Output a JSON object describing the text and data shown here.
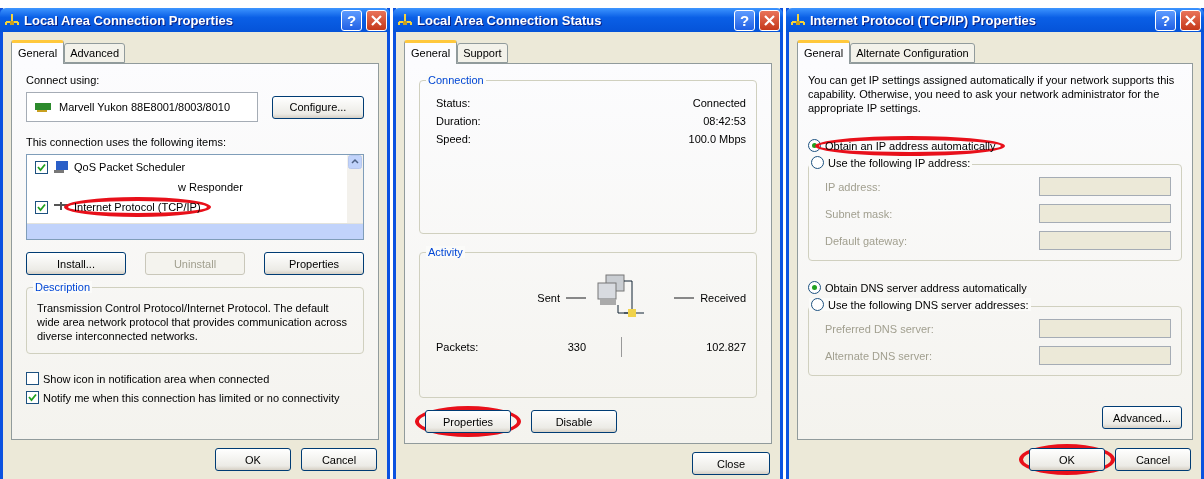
{
  "properties_dialog": {
    "title": "Local Area Connection Properties",
    "help_glyph": "?",
    "tabs": [
      {
        "label": "General",
        "selected": true
      },
      {
        "label": "Advanced",
        "selected": false
      }
    ],
    "connect_using_label": "Connect using:",
    "adapter": "Marvell Yukon 88E8001/8003/8010",
    "configure_button": "Configure...",
    "items_label": "This connection uses the following items:",
    "items": [
      {
        "label": "QoS Packet Scheduler",
        "checked": true,
        "highlighted": false
      },
      {
        "label": "w Responder",
        "highlighted": false
      },
      {
        "label": "Internet Protocol (TCP/IP)",
        "checked": true,
        "highlighted": true
      }
    ],
    "item_buttons": [
      {
        "label": "Install...",
        "disabled": false
      },
      {
        "label": "Uninstall",
        "disabled": true
      },
      {
        "label": "Properties",
        "disabled": false
      }
    ],
    "description": {
      "title": "Description",
      "text": "Transmission Control Protocol/Internet Protocol. The default wide area network protocol that provides communication across diverse interconnected networks."
    },
    "options": [
      {
        "label": "Show icon in notification area when connected",
        "checked": false
      },
      {
        "label": "Notify me when this connection has limited or no connectivity",
        "checked": true
      }
    ],
    "footer_buttons": [
      {
        "label": "OK",
        "highlighted": false
      },
      {
        "label": "Cancel",
        "highlighted": false
      }
    ]
  },
  "status_dialog": {
    "title": "Local Area Connection Status",
    "help_glyph": "?",
    "tabs": [
      {
        "label": "General",
        "selected": true
      },
      {
        "label": "Support",
        "selected": false
      }
    ],
    "connection": {
      "title": "Connection",
      "rows": [
        {
          "label": "Status:",
          "value": "Connected"
        },
        {
          "label": "Duration:",
          "value": "08:42:53"
        },
        {
          "label": "Speed:",
          "value": "100.0 Mbps"
        }
      ]
    },
    "activity": {
      "title": "Activity",
      "sent_label": "Sent",
      "received_label": "Received",
      "packets_label": "Packets:",
      "sent": "330",
      "received": "102.827"
    },
    "action_buttons": [
      {
        "label": "Properties",
        "highlighted": true
      },
      {
        "label": "Disable",
        "highlighted": false
      }
    ],
    "footer_buttons": [
      {
        "label": "Close",
        "highlighted": false
      }
    ]
  },
  "tcpip_dialog": {
    "title": "Internet Protocol (TCP/IP) Properties",
    "help_glyph": "?",
    "tabs": [
      {
        "label": "General",
        "selected": true
      },
      {
        "label": "Alternate Configuration",
        "selected": false
      }
    ],
    "intro": "You can get IP settings assigned automatically if your network supports this capability. Otherwise, you need to ask your network administrator for the appropriate IP settings.",
    "ip_options": [
      {
        "label": "Obtain an IP address automatically",
        "selected": true,
        "highlighted": true
      },
      {
        "label": "Use the following IP address:",
        "selected": false,
        "highlighted": false
      }
    ],
    "ip_fields": [
      {
        "label": "IP address:"
      },
      {
        "label": "Subnet mask:"
      },
      {
        "label": "Default gateway:"
      }
    ],
    "dns_options": [
      {
        "label": "Obtain DNS server address automatically",
        "selected": true,
        "highlighted": false
      },
      {
        "label": "Use the following DNS server addresses:",
        "selected": false,
        "highlighted": false
      }
    ],
    "dns_fields": [
      {
        "label": "Preferred DNS server:"
      },
      {
        "label": "Alternate DNS server:"
      }
    ],
    "advanced_button": "Advanced...",
    "footer_buttons": [
      {
        "label": "OK",
        "highlighted": true
      },
      {
        "label": "Cancel",
        "highlighted": false
      }
    ]
  }
}
